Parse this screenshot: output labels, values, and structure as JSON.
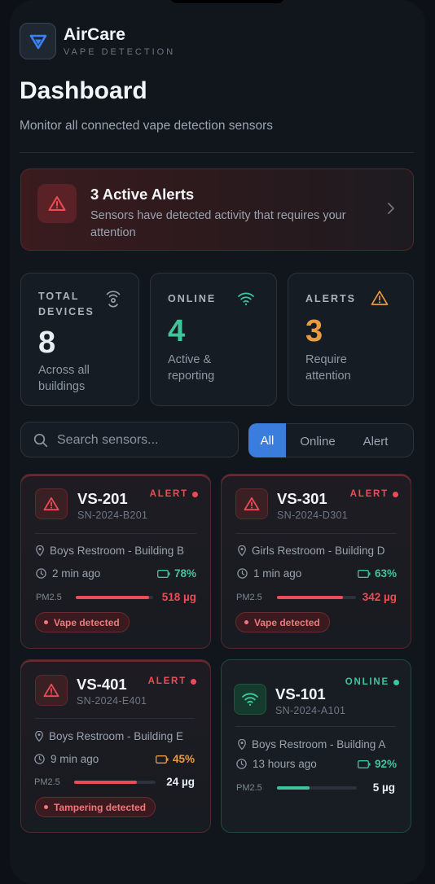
{
  "app": {
    "name": "AirCare",
    "subtitle": "VAPE DETECTION"
  },
  "page": {
    "title": "Dashboard",
    "subtitle": "Monitor all connected vape detection sensors"
  },
  "alert_banner": {
    "title": "3 Active Alerts",
    "text": "Sensors have detected activity that requires your attention"
  },
  "stats": [
    {
      "label": "TOTAL DEVICES",
      "value": "8",
      "desc": "Across all buildings",
      "color": "#f3f6f9"
    },
    {
      "label": "ONLINE",
      "value": "4",
      "desc": "Active & reporting",
      "color": "#3fc59a"
    },
    {
      "label": "ALERTS",
      "value": "3",
      "desc": "Require attention",
      "color": "#eb9b3f"
    }
  ],
  "search": {
    "placeholder": "Search sensors..."
  },
  "filters": {
    "all": "All",
    "online": "Online",
    "alert": "Alert",
    "selected": "All"
  },
  "colors": {
    "alert": "#ef4b55",
    "online": "#3fc59a",
    "warning": "#eb9b3f",
    "accent": "#3b7ddd"
  },
  "devices": [
    {
      "name": "VS-201",
      "serial": "SN-2024-B201",
      "status": "ALERT",
      "location": "Boys Restroom - Building B",
      "last_seen": "2 min ago",
      "battery": "78%",
      "pm_label": "PM2.5",
      "pm_value": "518 µg",
      "pm_level": 0.95,
      "tag": "Vape detected",
      "icon": "warning-icon"
    },
    {
      "name": "VS-301",
      "serial": "SN-2024-D301",
      "status": "ALERT",
      "location": "Girls Restroom - Building D",
      "last_seen": "1 min ago",
      "battery": "63%",
      "pm_label": "PM2.5",
      "pm_value": "342 µg",
      "pm_level": 0.84,
      "tag": "Vape detected",
      "icon": "warning-icon"
    },
    {
      "name": "VS-401",
      "serial": "SN-2024-E401",
      "status": "ALERT",
      "location": "Boys Restroom - Building E",
      "last_seen": "9 min ago",
      "battery": "45%",
      "pm_label": "PM2.5",
      "pm_value": "24 µg",
      "pm_level": 0.77,
      "tag": "Tampering detected",
      "icon": "warning-icon"
    },
    {
      "name": "VS-101",
      "serial": "SN-2024-A101",
      "status": "ONLINE",
      "location": "Boys Restroom - Building A",
      "last_seen": "13 hours ago",
      "battery": "92%",
      "pm_label": "PM2.5",
      "pm_value": "5 µg",
      "pm_level": 0.41,
      "tag": "",
      "icon": "wifi-icon"
    }
  ]
}
